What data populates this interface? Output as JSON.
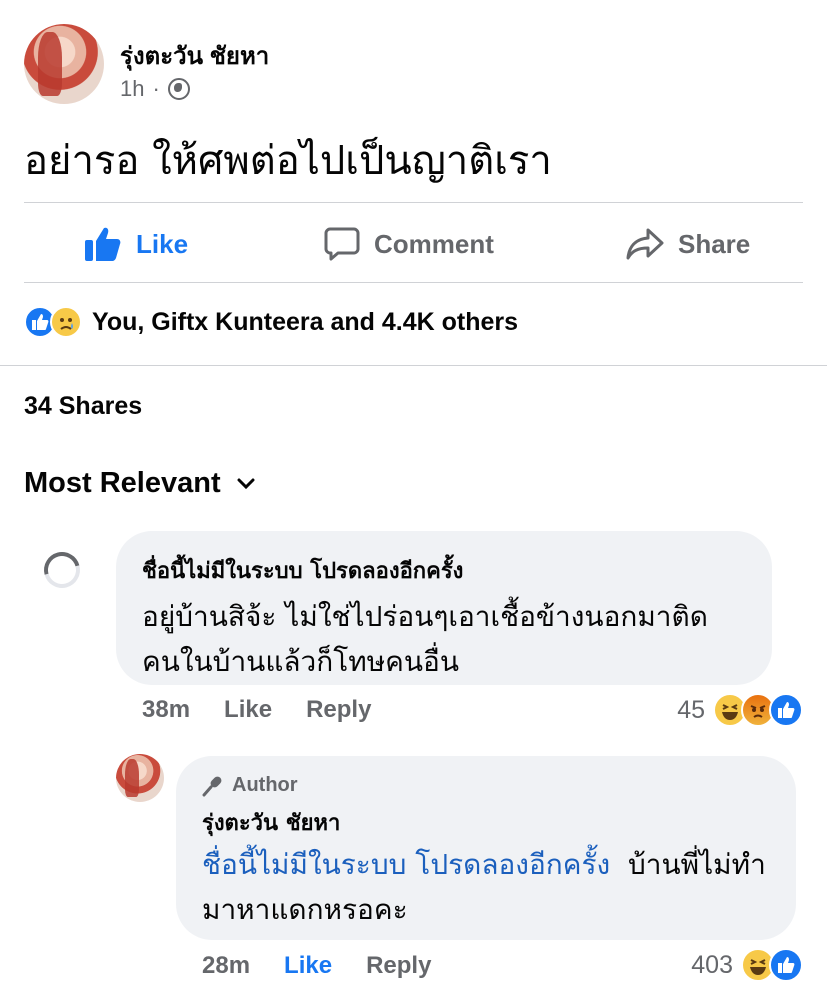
{
  "post": {
    "author": "รุ่งตะวัน ชัยหา",
    "time": "1h",
    "dot": "·",
    "text": "อย่ารอ ให้ศพต่อไปเป็นญาติเรา"
  },
  "actions": {
    "like": "Like",
    "comment": "Comment",
    "share": "Share"
  },
  "reactions": {
    "summary": "You, Giftx Kunteera and 4.4K others",
    "icons": [
      "like-icon",
      "sad-icon"
    ]
  },
  "shares": "34 Shares",
  "sort": {
    "label": "Most Relevant"
  },
  "comments": [
    {
      "name": "ชื่อนี้ไม่มีในระบบ โปรดลองอีกครั้ง",
      "text": "อยู่บ้านสิจ้ะ ไม่ใช่ไปร่อนๆเอาเชื้อข้างนอกมาติด คนในบ้านแล้วก็โทษคนอื่น",
      "time": "38m",
      "like": "Like",
      "reply": "Reply",
      "reaction_count": "45",
      "reaction_icons": [
        "haha-icon",
        "angry-icon",
        "like-icon"
      ]
    },
    {
      "badge": "Author",
      "name": "รุ่งตะวัน ชัยหา",
      "mention": "ชื่อนี้ไม่มีในระบบ โปรดลองอีกครั้ง",
      "text": "บ้านพี่ไม่ทำมาหาแดกหรอคะ",
      "time": "28m",
      "like": "Like",
      "reply": "Reply",
      "reaction_count": "403",
      "reaction_icons": [
        "haha-icon",
        "like-icon"
      ]
    }
  ],
  "colors": {
    "brand_blue": "#1877f2",
    "secondary_text": "#65676b",
    "bubble_bg": "#f0f2f5",
    "mention": "#1b5fbd"
  }
}
